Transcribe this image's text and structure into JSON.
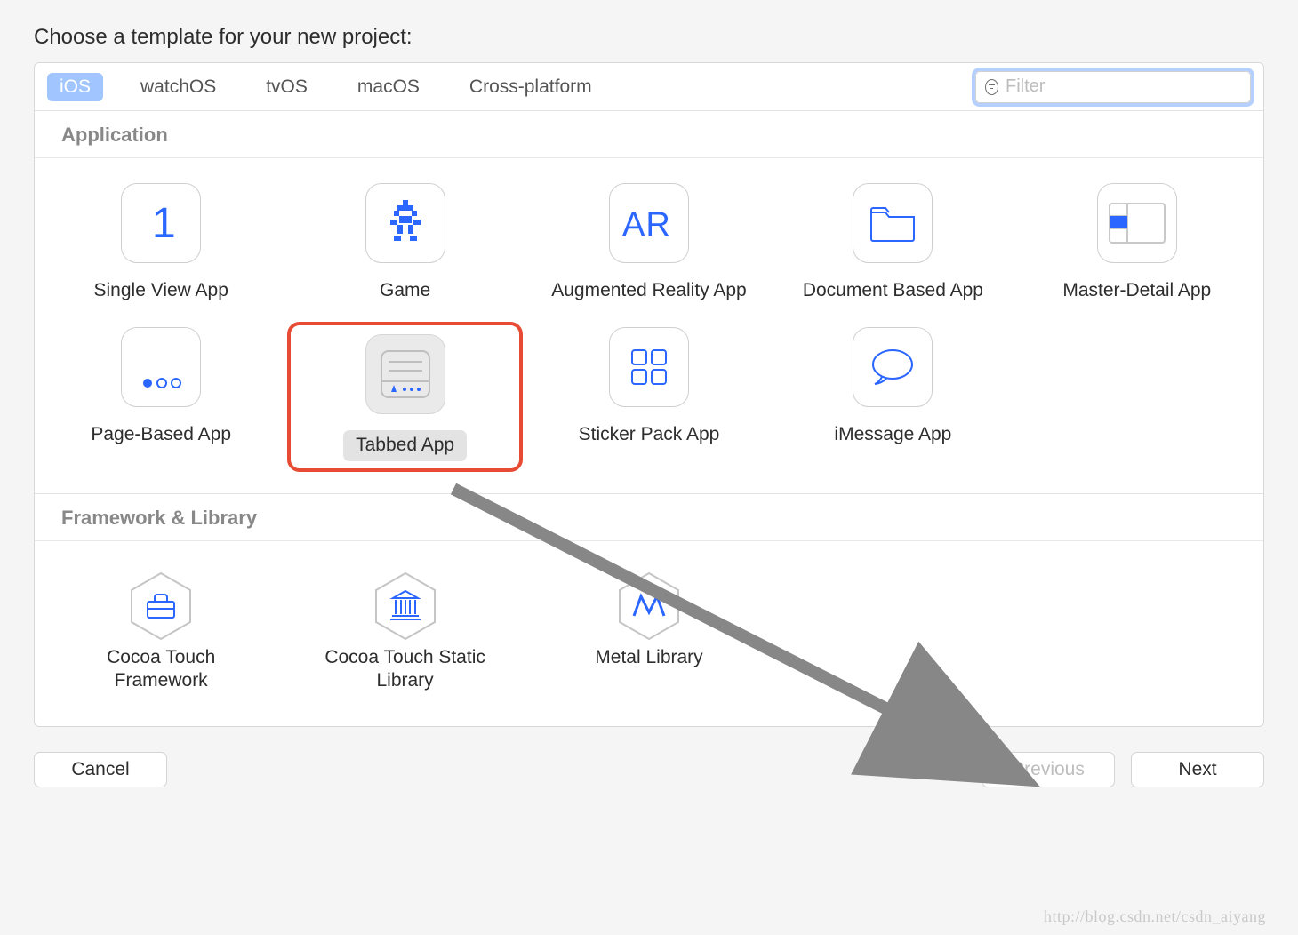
{
  "heading": "Choose a template for your new project:",
  "platforms": [
    "iOS",
    "watchOS",
    "tvOS",
    "macOS",
    "Cross-platform"
  ],
  "active_platform": "iOS",
  "filter_placeholder": "Filter",
  "sections": {
    "application": {
      "title": "Application",
      "items": [
        {
          "label": "Single View App",
          "icon": "single-view"
        },
        {
          "label": "Game",
          "icon": "game"
        },
        {
          "label": "Augmented Reality App",
          "icon": "ar"
        },
        {
          "label": "Document Based App",
          "icon": "document"
        },
        {
          "label": "Master-Detail App",
          "icon": "master-detail"
        },
        {
          "label": "Page-Based App",
          "icon": "page-based"
        },
        {
          "label": "Tabbed App",
          "icon": "tabbed",
          "selected": true
        },
        {
          "label": "Sticker Pack App",
          "icon": "sticker"
        },
        {
          "label": "iMessage App",
          "icon": "imessage"
        }
      ]
    },
    "framework": {
      "title": "Framework & Library",
      "items": [
        {
          "label": "Cocoa Touch Framework",
          "icon": "toolbox"
        },
        {
          "label": "Cocoa Touch Static Library",
          "icon": "library"
        },
        {
          "label": "Metal Library",
          "icon": "metal"
        }
      ]
    }
  },
  "buttons": {
    "cancel": "Cancel",
    "previous": "Previous",
    "next": "Next"
  },
  "watermark": "http://blog.csdn.net/csdn_aiyang"
}
